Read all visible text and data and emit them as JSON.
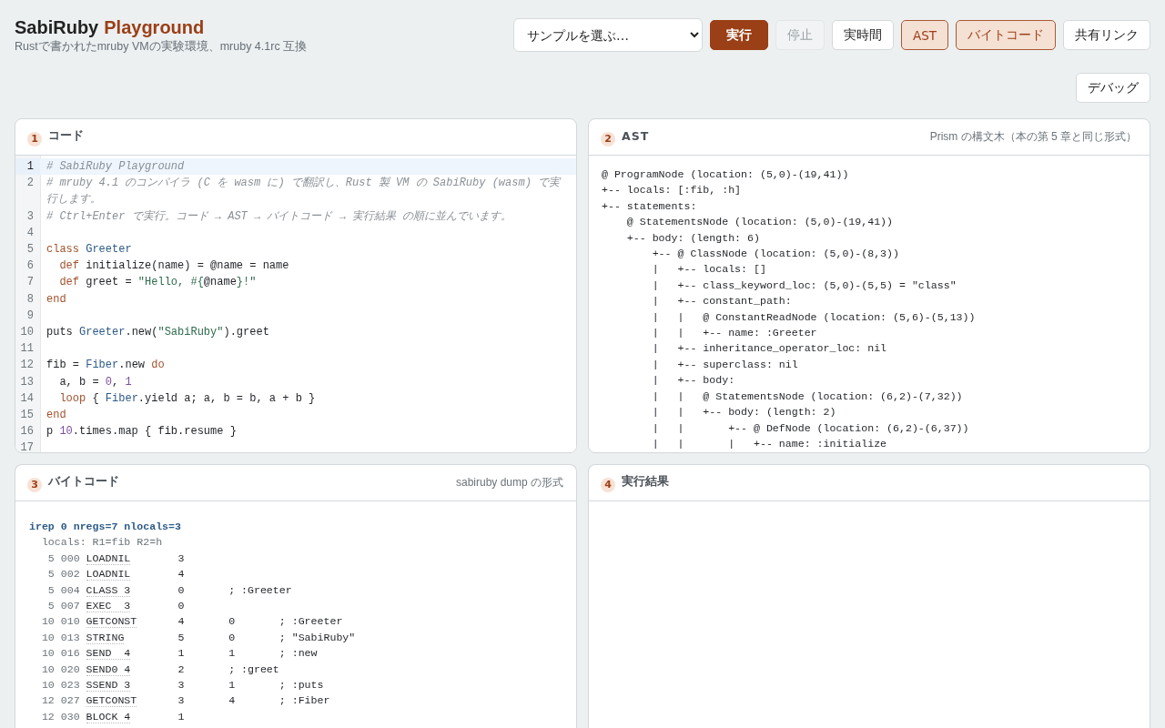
{
  "header": {
    "title": "SabiRuby",
    "title_accent": "Playground",
    "subtitle": "Rustで書かれたmruby VMの実験環境、mruby 4.1rc 互換"
  },
  "toolbar": {
    "sample_select": {
      "value": "サンプルを選ぶ…"
    },
    "buttons": [
      {
        "label": "実行",
        "kind": "primary",
        "disabled": false,
        "pressed": false
      },
      {
        "label": "停止",
        "kind": "plain",
        "disabled": true,
        "pressed": false
      },
      {
        "label": "実時間",
        "kind": "plain",
        "disabled": false,
        "pressed": false
      },
      {
        "label": "AST",
        "kind": "plain",
        "disabled": false,
        "pressed": true
      },
      {
        "label": "バイトコード",
        "kind": "plain",
        "disabled": false,
        "pressed": true
      },
      {
        "label": "共有リンク",
        "kind": "plain",
        "disabled": false,
        "pressed": false
      },
      {
        "label": "デバッグ",
        "kind": "plain",
        "disabled": false,
        "pressed": false
      }
    ]
  },
  "panels": [
    {
      "kind": "code",
      "number": "1",
      "title": "コード",
      "lines": [
        {
          "number": "1",
          "active": true,
          "segments": [
            {
              "kind": "com",
              "text": "# SabiRuby Playground"
            }
          ]
        },
        {
          "number": "2",
          "active": false,
          "segments": [
            {
              "kind": "com",
              "text": "# mruby 4.1 のコンパイラ (C を wasm に) で翻訳し、Rust 製 VM の SabiRuby (wasm) で実行します。"
            }
          ]
        },
        {
          "number": "3",
          "active": false,
          "segments": [
            {
              "kind": "com",
              "text": "# Ctrl+Enter で実行。コード → AST → バイトコード → 実行結果 の順に並んでいます。"
            }
          ]
        },
        {
          "number": "4",
          "active": false
        },
        {
          "number": "5",
          "active": false,
          "segments": [
            {
              "kind": "kw",
              "text": "class"
            },
            {
              "kind": "const",
              "text": " Greeter"
            }
          ]
        },
        {
          "number": "6",
          "active": false,
          "segments": [
            {
              "kind": "kw",
              "text": "  def"
            },
            {
              "kind": "plain",
              "text": " initialize(name) = @name = name"
            }
          ]
        },
        {
          "number": "7",
          "active": false,
          "segments": [
            {
              "kind": "kw",
              "text": "  def"
            },
            {
              "kind": "plain",
              "text": " greet = "
            },
            {
              "kind": "str",
              "text": "\"Hello, #{"
            },
            {
              "kind": "plain",
              "text": "@name"
            },
            {
              "kind": "str",
              "text": "}!\""
            }
          ]
        },
        {
          "number": "8",
          "active": false,
          "segments": [
            {
              "kind": "kw",
              "text": "end"
            }
          ]
        },
        {
          "number": "9",
          "active": false
        },
        {
          "number": "10",
          "active": false,
          "segments": [
            {
              "kind": "plain",
              "text": "puts "
            },
            {
              "kind": "const",
              "text": "Greeter"
            },
            {
              "kind": "plain",
              "text": ".new("
            },
            {
              "kind": "str",
              "text": "\"SabiRuby\""
            },
            {
              "kind": "plain",
              "text": ").greet"
            }
          ]
        },
        {
          "number": "11",
          "active": false
        },
        {
          "number": "12",
          "active": false,
          "segments": [
            {
              "kind": "plain",
              "text": "fib = "
            },
            {
              "kind": "const",
              "text": "Fiber"
            },
            {
              "kind": "plain",
              "text": ".new "
            },
            {
              "kind": "kw",
              "text": "do"
            }
          ]
        },
        {
          "number": "13",
          "active": false,
          "segments": [
            {
              "kind": "plain",
              "text": "  a, b = "
            },
            {
              "kind": "num",
              "text": "0"
            },
            {
              "kind": "plain",
              "text": ", "
            },
            {
              "kind": "num",
              "text": "1"
            }
          ]
        },
        {
          "number": "14",
          "active": false,
          "segments": [
            {
              "kind": "kw",
              "text": "  loop"
            },
            {
              "kind": "plain",
              "text": " { "
            },
            {
              "kind": "const",
              "text": "Fiber"
            },
            {
              "kind": "plain",
              "text": ".yield a; a, b = b, a + b }"
            }
          ]
        },
        {
          "number": "15",
          "active": false,
          "segments": [
            {
              "kind": "kw",
              "text": "end"
            }
          ]
        },
        {
          "number": "16",
          "active": false,
          "segments": [
            {
              "kind": "plain",
              "text": "p "
            },
            {
              "kind": "num",
              "text": "10"
            },
            {
              "kind": "plain",
              "text": ".times.map { fib.resume }"
            }
          ]
        },
        {
          "number": "17",
          "active": false
        }
      ]
    },
    {
      "kind": "ast",
      "number": "2",
      "title": "AST",
      "note": "Prism の構文木（本の第 5 章と同じ形式）",
      "lines": [
        "@ ProgramNode (location: (5,0)-(19,41))",
        "+-- locals: [:fib, :h]",
        "+-- statements:",
        "    @ StatementsNode (location: (5,0)-(19,41))",
        "    +-- body: (length: 6)",
        "        +-- @ ClassNode (location: (5,0)-(8,3))",
        "        |   +-- locals: []",
        "        |   +-- class_keyword_loc: (5,0)-(5,5) = \"class\"",
        "        |   +-- constant_path:",
        "        |   |   @ ConstantReadNode (location: (5,6)-(5,13))",
        "        |   |   +-- name: :Greeter",
        "        |   +-- inheritance_operator_loc: nil",
        "        |   +-- superclass: nil",
        "        |   +-- body:",
        "        |   |   @ StatementsNode (location: (6,2)-(7,32))",
        "        |   |   +-- body: (length: 2)",
        "        |   |       +-- @ DefNode (location: (6,2)-(6,37))",
        "        |   |       |   +-- name: :initialize"
      ]
    },
    {
      "kind": "bytecode",
      "number": "3",
      "title": "バイトコード",
      "note": "sabiruby dump の形式",
      "irep": "irep 0 nregs=7 nlocals=3",
      "locals": "locals: R1=fib R2=h",
      "rows": [
        {
          "line": "5",
          "addr": "000",
          "op": "LOADNIL",
          "cols": [
            "3"
          ]
        },
        {
          "line": "5",
          "addr": "002",
          "op": "LOADNIL",
          "cols": [
            "4"
          ]
        },
        {
          "line": "5",
          "addr": "004",
          "op": "CLASS 3",
          "cols": [
            "0",
            "; :Greeter"
          ]
        },
        {
          "line": "5",
          "addr": "007",
          "op": "EXEC  3",
          "cols": [
            "0"
          ]
        },
        {
          "line": "10",
          "addr": "010",
          "op": "GETCONST",
          "cols": [
            "4",
            "0",
            "; :Greeter"
          ]
        },
        {
          "line": "10",
          "addr": "013",
          "op": "STRING",
          "cols": [
            "5",
            "0",
            "; \"SabiRuby\""
          ]
        },
        {
          "line": "10",
          "addr": "016",
          "op": "SEND  4",
          "cols": [
            "1",
            "1",
            "; :new"
          ]
        },
        {
          "line": "10",
          "addr": "020",
          "op": "SEND0 4",
          "cols": [
            "2",
            "; :greet"
          ]
        },
        {
          "line": "10",
          "addr": "023",
          "op": "SSEND 3",
          "cols": [
            "3",
            "1",
            "; :puts"
          ]
        },
        {
          "line": "12",
          "addr": "027",
          "op": "GETCONST",
          "cols": [
            "3",
            "4",
            "; :Fiber"
          ]
        },
        {
          "line": "12",
          "addr": "030",
          "op": "BLOCK 4",
          "cols": [
            "1"
          ]
        }
      ]
    },
    {
      "kind": "output",
      "number": "4",
      "title": "実行結果"
    }
  ]
}
